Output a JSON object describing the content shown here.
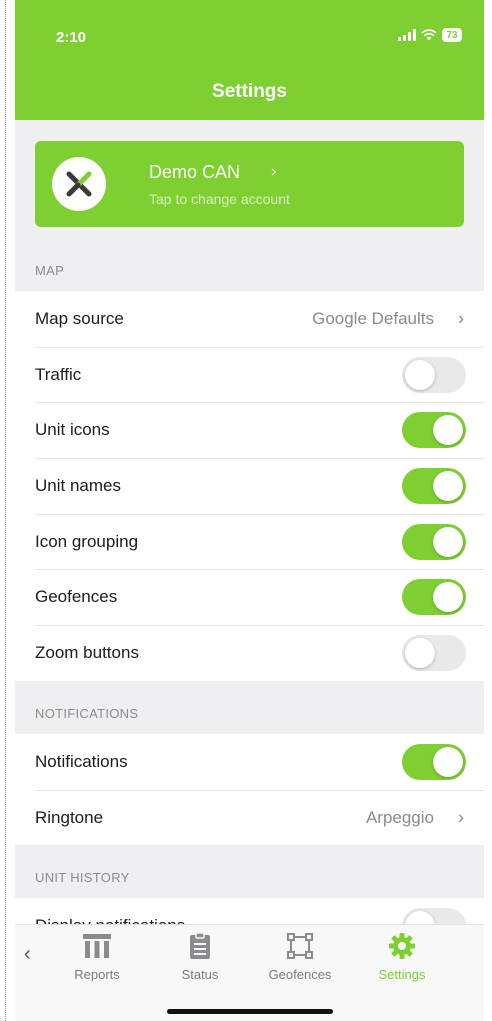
{
  "status_bar": {
    "time": "2:10",
    "battery": "73"
  },
  "header": {
    "title": "Settings"
  },
  "account": {
    "name": "Demo CAN",
    "chevron": "›",
    "subtitle": "Tap to change account"
  },
  "sections": {
    "map": {
      "header": "MAP",
      "map_source": {
        "label": "Map source",
        "value": "Google Defaults",
        "chevron": "›"
      },
      "traffic": {
        "label": "Traffic",
        "enabled": false
      },
      "unit_icons": {
        "label": "Unit icons",
        "enabled": true
      },
      "unit_names": {
        "label": "Unit names",
        "enabled": true
      },
      "icon_grouping": {
        "label": "Icon grouping",
        "enabled": true
      },
      "geofences": {
        "label": "Geofences",
        "enabled": true
      },
      "zoom_buttons": {
        "label": "Zoom buttons",
        "enabled": false
      }
    },
    "notifications": {
      "header": "NOTIFICATIONS",
      "notifications": {
        "label": "Notifications",
        "enabled": true
      },
      "ringtone": {
        "label": "Ringtone",
        "value": "Arpeggio",
        "chevron": "›"
      }
    },
    "unit_history": {
      "header": "UNIT HISTORY",
      "display_notifications": {
        "label": "Display notifications",
        "enabled": false
      }
    }
  },
  "tabbar": {
    "back": "‹",
    "tabs": [
      {
        "label": "Reports",
        "icon": "reports-icon",
        "active": false
      },
      {
        "label": "Status",
        "icon": "clipboard-icon",
        "active": false
      },
      {
        "label": "Geofences",
        "icon": "geofence-icon",
        "active": false
      },
      {
        "label": "Settings",
        "icon": "gear-icon",
        "active": true
      }
    ]
  },
  "colors": {
    "accent": "#7ed032",
    "background": "#efeff2",
    "toggle_off": "#e9e9ea"
  }
}
